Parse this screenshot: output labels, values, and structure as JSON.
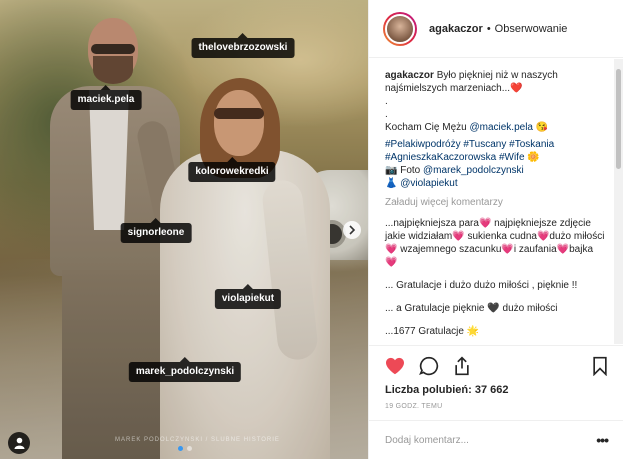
{
  "photo": {
    "tags": [
      {
        "name": "thelovebrzozowski"
      },
      {
        "name": "maciek.pela"
      },
      {
        "name": "kolorowekredki"
      },
      {
        "name": "signorleone"
      },
      {
        "name": "violapiekut"
      },
      {
        "name": "marek_podolczynski"
      }
    ],
    "watermark": "MAREK PODOLCZYNSKI / SLUBNE HISTORIE",
    "next_icon": "chevron-right-icon",
    "user_tag_icon": "person-icon"
  },
  "header": {
    "username": "agakaczor",
    "separator": "•",
    "follow_label": "Obserwowanie"
  },
  "caption": {
    "user": "agakaczor",
    "line1": "Było piękniej niż w naszych najśmielszych marzeniach...❤️",
    "dot1": ".",
    "dot2": ".",
    "line2_text": "Kocham Cię Mężu ",
    "line2_mention": "@maciek.pela",
    "line2_emoji": " 😘",
    "line3": "#Pelakiwpodróży #Tuscany #Toskania #AgnieszkaKaczorowska #Wife 🌼",
    "line4_prefix": "📷 Foto ",
    "line4_mention": "@marek_podolczynski",
    "line5_prefix": "👗 ",
    "line5_mention": "@violapiekut"
  },
  "load_more": "Załaduj więcej komentarzy",
  "comments": [
    {
      "text": "...najpiękniejsza para💗 najpiękniejsze zdjęcie jakie widziałam💗 sukienka cudna💗dużo miłości💗 wzajemnego szacunku💗i zaufania💗bajka💗"
    },
    {
      "text": "... Gratulacje i dużo dużo miłości , pięknie !!"
    },
    {
      "text": "... a Gratulacje pięknie 🖤 dużo miłości"
    },
    {
      "text": "...1677 Gratulacje 🌟"
    }
  ],
  "actions": {
    "like_icon": "heart-icon",
    "comment_icon": "comment-icon",
    "share_icon": "share-icon",
    "save_icon": "bookmark-icon",
    "liked": true
  },
  "likes": {
    "label": "Liczba polubień: 37 662"
  },
  "time": "19 GODZ. TEMU",
  "add_comment": {
    "placeholder": "Dodaj komentarz...",
    "more_icon": "ellipsis-icon"
  },
  "colors": {
    "like_red": "#ed4956",
    "link_blue": "#003569",
    "dot_active": "#3897f0"
  }
}
